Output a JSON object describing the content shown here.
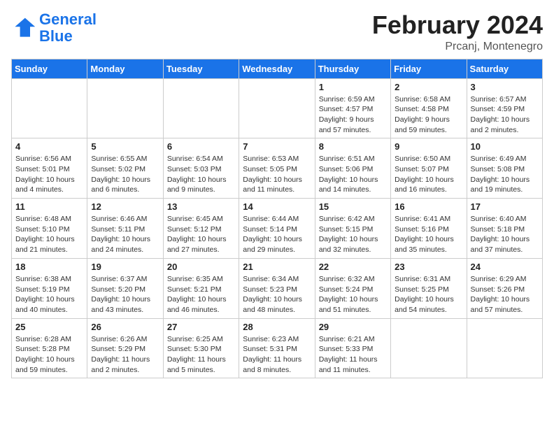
{
  "header": {
    "logo_line1": "General",
    "logo_line2": "Blue",
    "month_year": "February 2024",
    "location": "Prcanj, Montenegro"
  },
  "weekdays": [
    "Sunday",
    "Monday",
    "Tuesday",
    "Wednesday",
    "Thursday",
    "Friday",
    "Saturday"
  ],
  "weeks": [
    [
      {
        "day": "",
        "info": ""
      },
      {
        "day": "",
        "info": ""
      },
      {
        "day": "",
        "info": ""
      },
      {
        "day": "",
        "info": ""
      },
      {
        "day": "1",
        "info": "Sunrise: 6:59 AM\nSunset: 4:57 PM\nDaylight: 9 hours\nand 57 minutes."
      },
      {
        "day": "2",
        "info": "Sunrise: 6:58 AM\nSunset: 4:58 PM\nDaylight: 9 hours\nand 59 minutes."
      },
      {
        "day": "3",
        "info": "Sunrise: 6:57 AM\nSunset: 4:59 PM\nDaylight: 10 hours\nand 2 minutes."
      }
    ],
    [
      {
        "day": "4",
        "info": "Sunrise: 6:56 AM\nSunset: 5:01 PM\nDaylight: 10 hours\nand 4 minutes."
      },
      {
        "day": "5",
        "info": "Sunrise: 6:55 AM\nSunset: 5:02 PM\nDaylight: 10 hours\nand 6 minutes."
      },
      {
        "day": "6",
        "info": "Sunrise: 6:54 AM\nSunset: 5:03 PM\nDaylight: 10 hours\nand 9 minutes."
      },
      {
        "day": "7",
        "info": "Sunrise: 6:53 AM\nSunset: 5:05 PM\nDaylight: 10 hours\nand 11 minutes."
      },
      {
        "day": "8",
        "info": "Sunrise: 6:51 AM\nSunset: 5:06 PM\nDaylight: 10 hours\nand 14 minutes."
      },
      {
        "day": "9",
        "info": "Sunrise: 6:50 AM\nSunset: 5:07 PM\nDaylight: 10 hours\nand 16 minutes."
      },
      {
        "day": "10",
        "info": "Sunrise: 6:49 AM\nSunset: 5:08 PM\nDaylight: 10 hours\nand 19 minutes."
      }
    ],
    [
      {
        "day": "11",
        "info": "Sunrise: 6:48 AM\nSunset: 5:10 PM\nDaylight: 10 hours\nand 21 minutes."
      },
      {
        "day": "12",
        "info": "Sunrise: 6:46 AM\nSunset: 5:11 PM\nDaylight: 10 hours\nand 24 minutes."
      },
      {
        "day": "13",
        "info": "Sunrise: 6:45 AM\nSunset: 5:12 PM\nDaylight: 10 hours\nand 27 minutes."
      },
      {
        "day": "14",
        "info": "Sunrise: 6:44 AM\nSunset: 5:14 PM\nDaylight: 10 hours\nand 29 minutes."
      },
      {
        "day": "15",
        "info": "Sunrise: 6:42 AM\nSunset: 5:15 PM\nDaylight: 10 hours\nand 32 minutes."
      },
      {
        "day": "16",
        "info": "Sunrise: 6:41 AM\nSunset: 5:16 PM\nDaylight: 10 hours\nand 35 minutes."
      },
      {
        "day": "17",
        "info": "Sunrise: 6:40 AM\nSunset: 5:18 PM\nDaylight: 10 hours\nand 37 minutes."
      }
    ],
    [
      {
        "day": "18",
        "info": "Sunrise: 6:38 AM\nSunset: 5:19 PM\nDaylight: 10 hours\nand 40 minutes."
      },
      {
        "day": "19",
        "info": "Sunrise: 6:37 AM\nSunset: 5:20 PM\nDaylight: 10 hours\nand 43 minutes."
      },
      {
        "day": "20",
        "info": "Sunrise: 6:35 AM\nSunset: 5:21 PM\nDaylight: 10 hours\nand 46 minutes."
      },
      {
        "day": "21",
        "info": "Sunrise: 6:34 AM\nSunset: 5:23 PM\nDaylight: 10 hours\nand 48 minutes."
      },
      {
        "day": "22",
        "info": "Sunrise: 6:32 AM\nSunset: 5:24 PM\nDaylight: 10 hours\nand 51 minutes."
      },
      {
        "day": "23",
        "info": "Sunrise: 6:31 AM\nSunset: 5:25 PM\nDaylight: 10 hours\nand 54 minutes."
      },
      {
        "day": "24",
        "info": "Sunrise: 6:29 AM\nSunset: 5:26 PM\nDaylight: 10 hours\nand 57 minutes."
      }
    ],
    [
      {
        "day": "25",
        "info": "Sunrise: 6:28 AM\nSunset: 5:28 PM\nDaylight: 10 hours\nand 59 minutes."
      },
      {
        "day": "26",
        "info": "Sunrise: 6:26 AM\nSunset: 5:29 PM\nDaylight: 11 hours\nand 2 minutes."
      },
      {
        "day": "27",
        "info": "Sunrise: 6:25 AM\nSunset: 5:30 PM\nDaylight: 11 hours\nand 5 minutes."
      },
      {
        "day": "28",
        "info": "Sunrise: 6:23 AM\nSunset: 5:31 PM\nDaylight: 11 hours\nand 8 minutes."
      },
      {
        "day": "29",
        "info": "Sunrise: 6:21 AM\nSunset: 5:33 PM\nDaylight: 11 hours\nand 11 minutes."
      },
      {
        "day": "",
        "info": ""
      },
      {
        "day": "",
        "info": ""
      }
    ]
  ]
}
